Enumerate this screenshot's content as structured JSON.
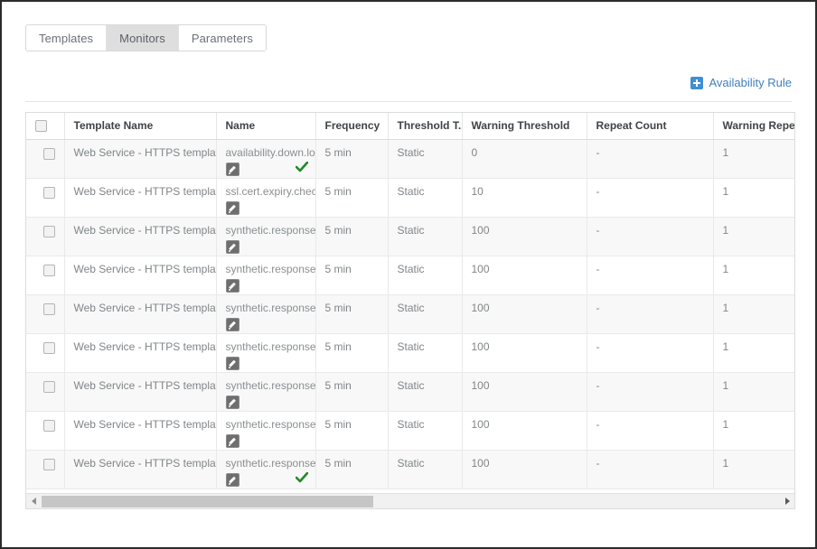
{
  "tabs": [
    {
      "label": "Templates",
      "active": false
    },
    {
      "label": "Monitors",
      "active": true
    },
    {
      "label": "Parameters",
      "active": false
    }
  ],
  "toolbar": {
    "availability_rule_label": "Availability Rule",
    "plus_icon": "plus-icon",
    "link_color": "#3f7fbf"
  },
  "table": {
    "columns": [
      {
        "key": "check",
        "label": ""
      },
      {
        "key": "template_name",
        "label": "Template Name"
      },
      {
        "key": "name",
        "label": "Name"
      },
      {
        "key": "frequency",
        "label": "Frequency"
      },
      {
        "key": "threshold_type",
        "label": "Threshold T..."
      },
      {
        "key": "warning_threshold",
        "label": "Warning Threshold"
      },
      {
        "key": "repeat_count",
        "label": "Repeat Count"
      },
      {
        "key": "warning_repeat_count",
        "label": "Warning Repeat C"
      },
      {
        "key": "extra",
        "label": ""
      }
    ],
    "rows": [
      {
        "template_name": "Web Service - HTTPS template",
        "name": "availability.down.loc",
        "frequency": "5 min",
        "threshold_type": "Static",
        "warning_threshold": "0",
        "repeat_count": "-",
        "warning_repeat_count": "1",
        "has_edit_icon": true,
        "has_check_icon": true
      },
      {
        "template_name": "Web Service - HTTPS template",
        "name": "ssl.cert.expiry.check",
        "frequency": "5 min",
        "threshold_type": "Static",
        "warning_threshold": "10",
        "repeat_count": "-",
        "warning_repeat_count": "1",
        "has_edit_icon": true,
        "has_check_icon": false
      },
      {
        "template_name": "Web Service - HTTPS template",
        "name": "synthetic.response.re",
        "frequency": "5 min",
        "threshold_type": "Static",
        "warning_threshold": "100",
        "repeat_count": "-",
        "warning_repeat_count": "1",
        "has_edit_icon": true,
        "has_check_icon": false
      },
      {
        "template_name": "Web Service - HTTPS template",
        "name": "synthetic.response.a",
        "frequency": "5 min",
        "threshold_type": "Static",
        "warning_threshold": "100",
        "repeat_count": "-",
        "warning_repeat_count": "1",
        "has_edit_icon": true,
        "has_check_icon": false
      },
      {
        "template_name": "Web Service - HTTPS template",
        "name": "synthetic.response.co",
        "frequency": "5 min",
        "threshold_type": "Static",
        "warning_threshold": "100",
        "repeat_count": "-",
        "warning_repeat_count": "1",
        "has_edit_icon": true,
        "has_check_icon": false
      },
      {
        "template_name": "Web Service - HTTPS template",
        "name": "synthetic.response.st",
        "frequency": "5 min",
        "threshold_type": "Static",
        "warning_threshold": "100",
        "repeat_count": "-",
        "warning_repeat_count": "1",
        "has_edit_icon": true,
        "has_check_icon": false
      },
      {
        "template_name": "Web Service - HTTPS template",
        "name": "synthetic.response.p",
        "frequency": "5 min",
        "threshold_type": "Static",
        "warning_threshold": "100",
        "repeat_count": "-",
        "warning_repeat_count": "1",
        "has_edit_icon": true,
        "has_check_icon": false
      },
      {
        "template_name": "Web Service - HTTPS template",
        "name": "synthetic.response.lo",
        "frequency": "5 min",
        "threshold_type": "Static",
        "warning_threshold": "100",
        "repeat_count": "-",
        "warning_repeat_count": "1",
        "has_edit_icon": true,
        "has_check_icon": false
      },
      {
        "template_name": "Web Service - HTTPS template",
        "name": "synthetic.response.ti",
        "frequency": "5 min",
        "threshold_type": "Static",
        "warning_threshold": "100",
        "repeat_count": "-",
        "warning_repeat_count": "1",
        "has_edit_icon": true,
        "has_check_icon": true
      }
    ]
  },
  "scrollbar": {
    "left_arrow": "triangle-left-icon",
    "right_arrow": "triangle-right-icon",
    "thumb_percent": 45
  }
}
